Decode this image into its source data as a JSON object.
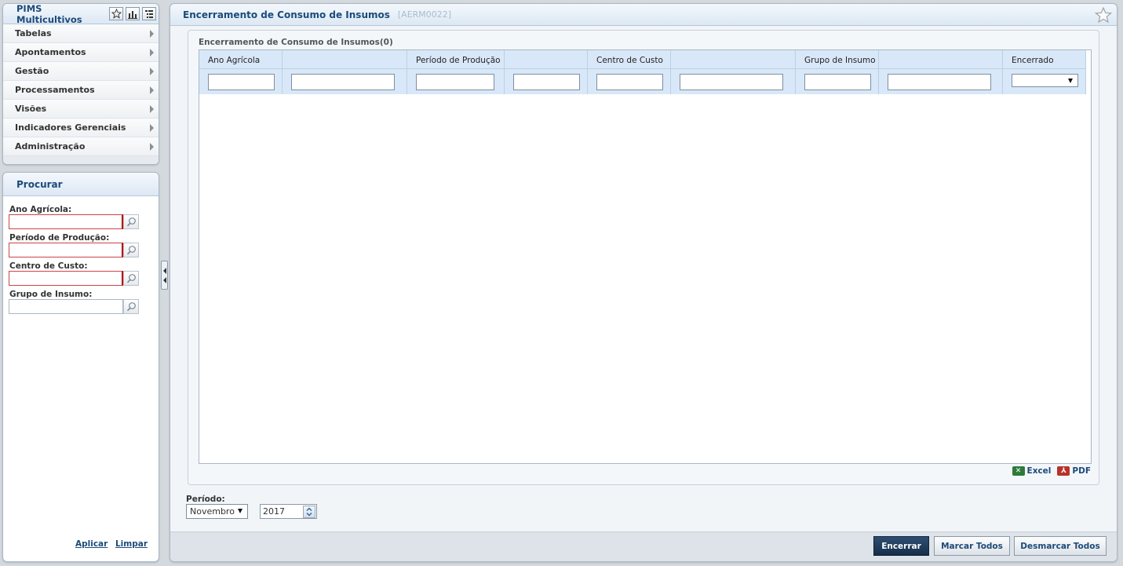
{
  "app": {
    "title": "PIMS Multicultivos"
  },
  "menu": {
    "items": [
      {
        "label": "Tabelas"
      },
      {
        "label": "Apontamentos"
      },
      {
        "label": "Gestão"
      },
      {
        "label": "Processamentos"
      },
      {
        "label": "Visões"
      },
      {
        "label": "Indicadores Gerenciais"
      },
      {
        "label": "Administração"
      }
    ]
  },
  "header_icons": [
    "star-icon",
    "bar-chart-icon",
    "tree-list-icon"
  ],
  "search": {
    "title": "Procurar",
    "fields": [
      {
        "label": "Ano Agrícola:",
        "value": "",
        "required": true
      },
      {
        "label": "Período de Produção:",
        "value": "",
        "required": true
      },
      {
        "label": "Centro de Custo:",
        "value": "",
        "required": true
      },
      {
        "label": "Grupo de Insumo:",
        "value": "",
        "required": false
      }
    ],
    "apply": "Aplicar",
    "clear": "Limpar"
  },
  "main": {
    "title": "Encerramento de Consumo de Insumos",
    "code": "[AERM0022]",
    "grid_caption": "Encerramento de Consumo de Insumos(0)",
    "columns": [
      {
        "label": "Ano Agrícola"
      },
      {
        "label": ""
      },
      {
        "label": "Período de Produção"
      },
      {
        "label": ""
      },
      {
        "label": "Centro de Custo"
      },
      {
        "label": ""
      },
      {
        "label": "Grupo de Insumo"
      },
      {
        "label": ""
      },
      {
        "label": "Encerrado"
      }
    ],
    "encerrado_filter_value": "",
    "exports": {
      "excel": "Excel",
      "pdf": "PDF"
    },
    "periodo": {
      "label": "Período:",
      "month": "Novembro",
      "year": "2017"
    },
    "buttons": {
      "encerrar": "Encerrar",
      "marcar": "Marcar Todos",
      "desmarcar": "Desmarcar Todos"
    }
  },
  "colors": {
    "accent": "#1c4a7a",
    "header_bg": "#d8e8f8",
    "primary_button": "#1f3a5c",
    "required_border": "#b00000"
  }
}
